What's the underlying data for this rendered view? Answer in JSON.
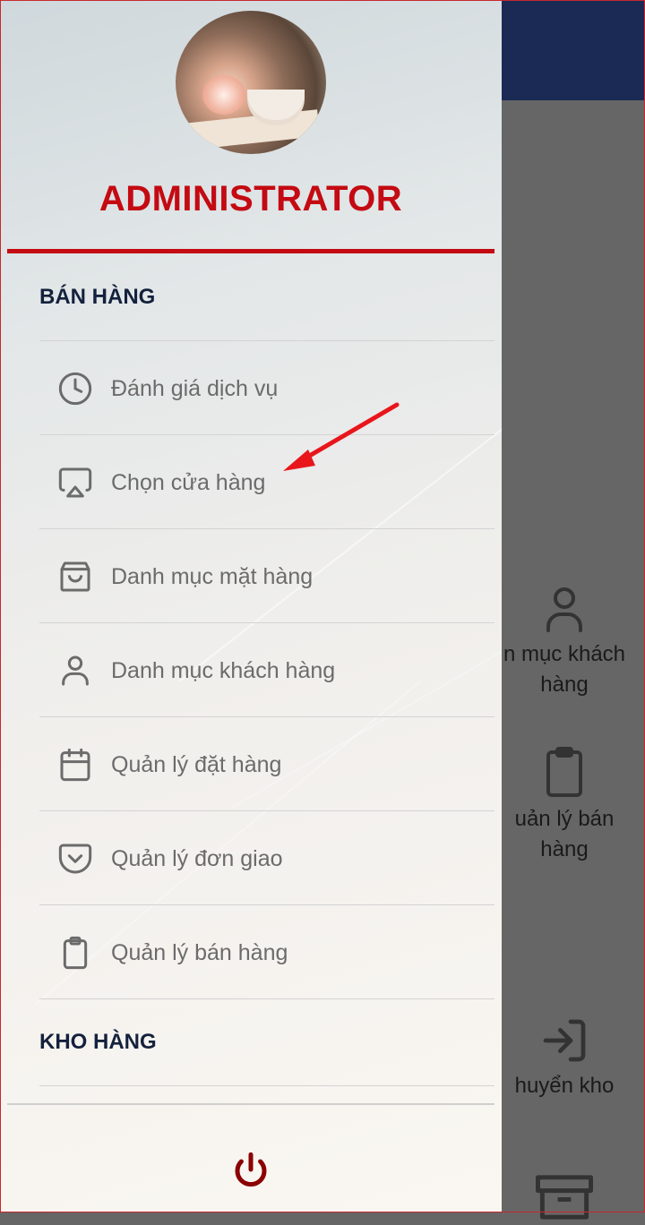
{
  "drawer": {
    "user_title": "ADMINISTRATOR",
    "sections": [
      {
        "title": "BÁN HÀNG",
        "items": [
          {
            "label": "Đánh giá dịch vụ",
            "icon": "clock-icon"
          },
          {
            "label": "Chọn cửa hàng",
            "icon": "airplay-icon"
          },
          {
            "label": "Danh mục mặt hàng",
            "icon": "shopping-bag-icon"
          },
          {
            "label": "Danh mục khách hàng",
            "icon": "user-icon"
          },
          {
            "label": "Quản lý đặt hàng",
            "icon": "calendar-icon"
          },
          {
            "label": "Quản lý đơn giao",
            "icon": "pocket-icon"
          },
          {
            "label": "Quản lý bán hàng",
            "icon": "clipboard-icon"
          }
        ]
      },
      {
        "title": "KHO HÀNG",
        "items": []
      }
    ],
    "logout_icon": "power-icon"
  },
  "background": {
    "tiles": [
      {
        "label": "n mục khách\nhàng",
        "icon": "user-icon"
      },
      {
        "label": "uản lý bán\nhàng",
        "icon": "clipboard-icon"
      },
      {
        "label": "huyển kho",
        "icon": "log-in-icon"
      },
      {
        "label": "",
        "icon": "archive-icon"
      }
    ]
  },
  "colors": {
    "accent": "#c40a12",
    "section_text": "#14213d",
    "item_text": "#6b6b6b",
    "topbar": "#1a2a55",
    "overlay": "#666666",
    "annotation_arrow": "#e8161b"
  }
}
